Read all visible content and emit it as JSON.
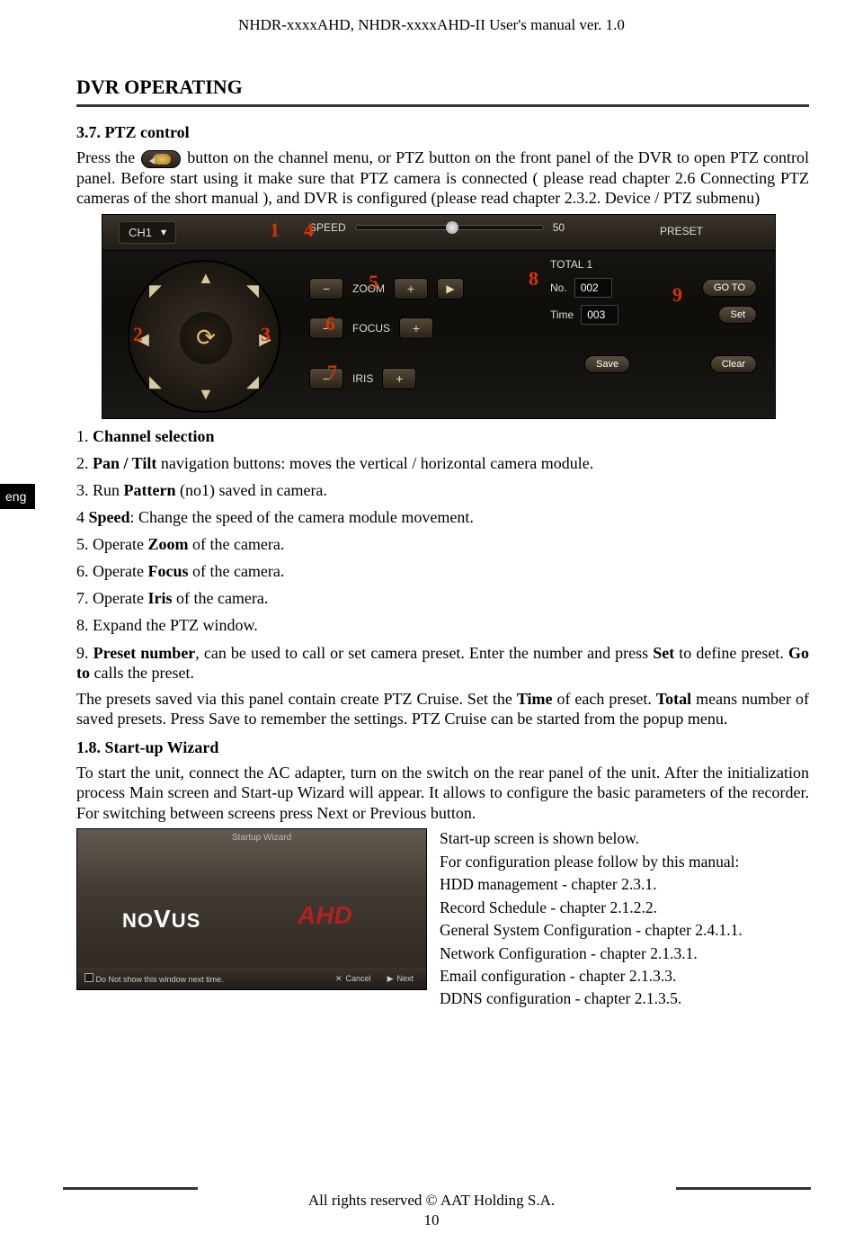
{
  "header": "NHDR-xxxxAHD, NHDR-xxxxAHD-II User's manual ver. 1.0",
  "title": "DVR OPERATING",
  "section37": "3.7. PTZ control",
  "intro1a": "Press  the ",
  "intro1b": " button on the channel menu, or PTZ button on the front panel of the DVR to open PTZ control panel. Before start using it make sure that PTZ camera is connected ( please read chapter 2.6 Connecting PTZ cameras of the short manual ), and DVR is configured (please read chapter 2.3.2. Device / PTZ submenu)",
  "ptz": {
    "ch": "CH1",
    "speed_label": "SPEED",
    "speed_val": "50",
    "preset": "PRESET",
    "zoom": "ZOOM",
    "focus": "FOCUS",
    "iris": "IRIS",
    "total": "TOTAL 1",
    "no_label": "No.",
    "no_val": "002",
    "time_label": "Time",
    "time_val": "003",
    "goto": "GO TO",
    "set": "Set",
    "save": "Save",
    "clear": "Clear"
  },
  "nums": {
    "n1": "1",
    "n2": "2",
    "n3": "3",
    "n4": "4",
    "n5": "5",
    "n6": "6",
    "n7": "7",
    "n8": "8",
    "n9": "9"
  },
  "eng": "eng",
  "list": {
    "i1a": "1. ",
    "i1b": "Channel selection",
    "i2a": "2. ",
    "i2b": "Pan / Tilt ",
    "i2c": "navigation buttons: moves the vertical / horizontal camera module.",
    "i3a": "3. Run ",
    "i3b": "Pattern ",
    "i3c": "(no1) saved in camera.",
    "i4a": "4 ",
    "i4b": "Speed",
    "i4c": ": Change the speed of the camera module movement.",
    "i5a": "5. Operate ",
    "i5b": "Zoom ",
    "i5c": "of the camera.",
    "i6a": "6. Operate ",
    "i6b": "Focus ",
    "i6c": "of the camera.",
    "i7a": "7. Operate ",
    "i7b": "Iris ",
    "i7c": "of the camera.",
    "i8": "8. Expand the PTZ window.",
    "i9a": "9. ",
    "i9b": "Preset number",
    "i9c": ", can be used to call or set camera preset. Enter the number and press ",
    "i9d": "Set ",
    "i9e": "to define preset. ",
    "i9f": "Go to ",
    "i9g": "calls the preset.",
    "p1a": "The presets saved via this panel contain create PTZ Cruise. Set the ",
    "p1b": "Time ",
    "p1c": "of each preset. ",
    "p1d": "Total ",
    "p1e": "means number of saved presets. Press Save to remember the settings. PTZ Cruise can be started from the popup menu."
  },
  "section18": "1.8. Start-up Wizard",
  "wiz_intro": "To start the unit, connect the AC adapter, turn on the switch on the rear panel of the unit. After the initialization process  Main screen and Start-up Wizard will appear. It allows to configure the basic parameters of the recorder. For switching between screens press Next or Previous button.",
  "wizard": {
    "title": "Startup Wizard",
    "dns": "Do Not show this window next time.",
    "cancel": "Cancel",
    "next": "Next",
    "novus_a": "NO",
    "novus_v": "V",
    "novus_b": "US",
    "ahd": "AHD"
  },
  "cfg": {
    "l1": "Start-up screen is shown below.",
    "l2": "For configuration please follow by this manual:",
    "l3": "HDD management - chapter 2.3.1.",
    "l4": "Record Schedule - chapter 2.1.2.2.",
    "l5": "General System Configuration - chapter 2.4.1.1.",
    "l6": "Network Configuration - chapter 2.1.3.1.",
    "l7": "Email configuration - chapter 2.1.3.3.",
    "l8": "DDNS configuration - chapter 2.1.3.5."
  },
  "footer": "All rights reserved © AAT Holding S.A.",
  "pagenum": "10"
}
